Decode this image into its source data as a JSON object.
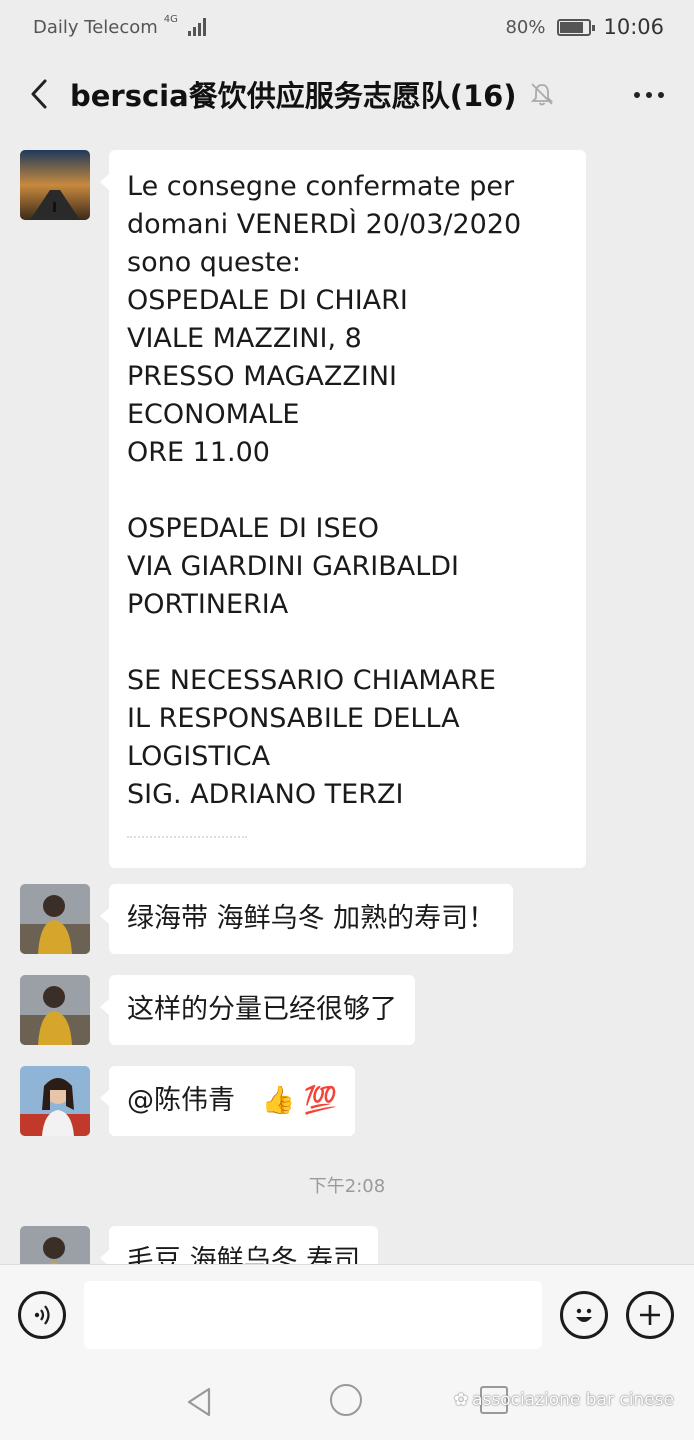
{
  "status_bar": {
    "carrier": "Daily Telecom",
    "network": "4G",
    "battery": "80%",
    "battery_level": 0.8,
    "time": "10:06"
  },
  "header": {
    "title": "berscia餐饮供应服务志愿队(16)",
    "back_icon": "back-arrow-icon",
    "mute_icon": "bell-muted-icon",
    "more_icon": "more-dots-icon"
  },
  "messages": [
    {
      "lines": [
        "Le consegne confermate per",
        "domani VENERDÌ 20/03/2020",
        "sono queste:",
        "OSPEDALE DI CHIARI",
        "VIALE MAZZINI, 8",
        "PRESSO MAGAZZINI",
        "ECONOMALE",
        "ORE 11.00",
        "",
        "OSPEDALE DI ISEO",
        "VIA GIARDINI GARIBALDI",
        "PORTINERIA",
        "",
        "SE NECESSARIO CHIAMARE",
        "IL RESPONSABILE DELLA",
        "LOGISTICA",
        "SIG. ADRIANO TERZI"
      ]
    },
    {
      "text": "绿海带 海鲜乌冬 加熟的寿司！"
    },
    {
      "text": "这样的分量已经很够了"
    },
    {
      "text": "@陈伟青",
      "emoji": [
        "👍",
        "💯"
      ]
    },
    {
      "text": "毛豆 海鲜乌冬 寿司"
    }
  ],
  "time_separator": "下午2:08",
  "input_bar": {
    "voice_icon": "voice-icon",
    "emoji_icon": "emoji-icon",
    "plus_icon": "plus-icon"
  },
  "watermark": "associazione bar cinese"
}
